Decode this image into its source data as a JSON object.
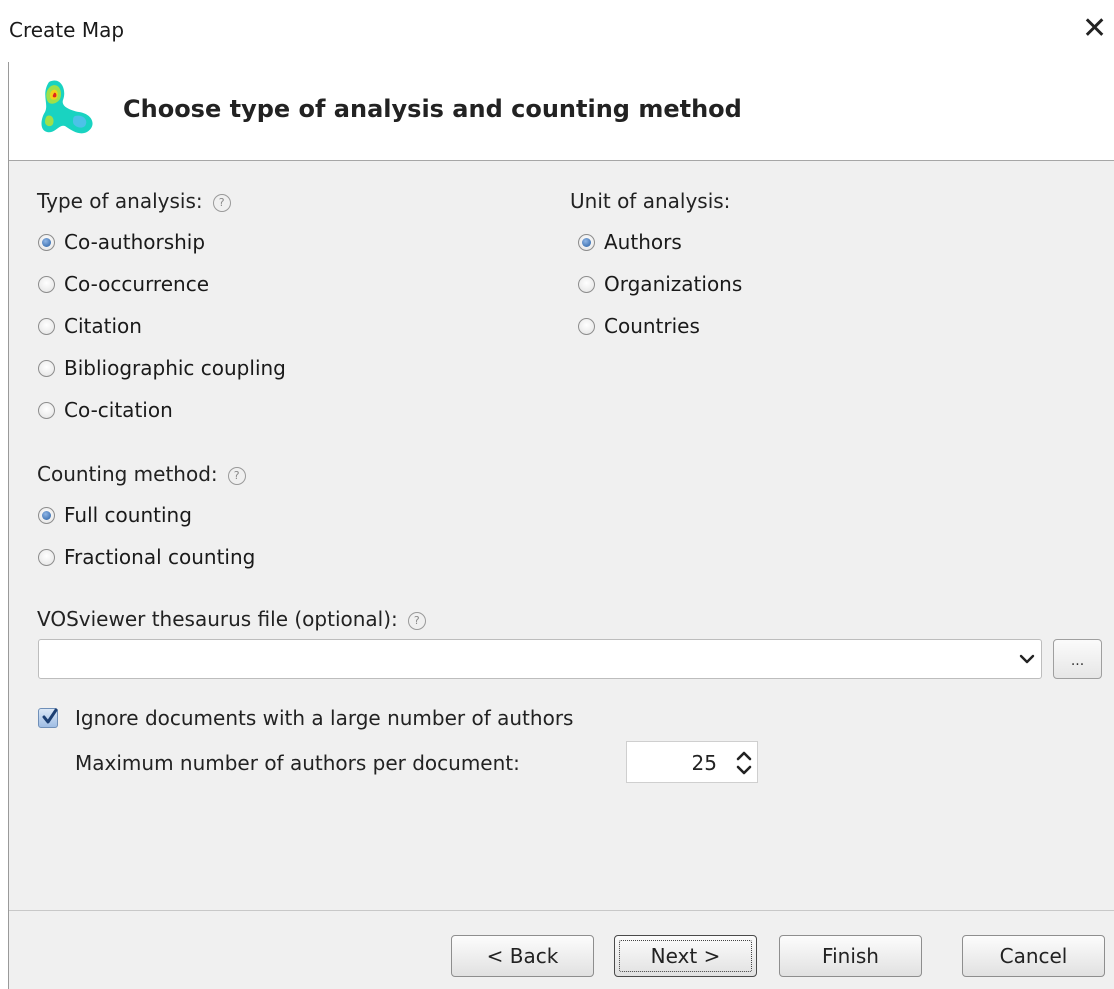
{
  "window": {
    "title": "Create Map"
  },
  "header": {
    "heading": "Choose type of analysis and counting method"
  },
  "type_of_analysis": {
    "label": "Type of analysis:",
    "options": [
      {
        "label": "Co-authorship",
        "checked": true
      },
      {
        "label": "Co-occurrence",
        "checked": false
      },
      {
        "label": "Citation",
        "checked": false
      },
      {
        "label": "Bibliographic coupling",
        "checked": false
      },
      {
        "label": "Co-citation",
        "checked": false
      }
    ]
  },
  "unit_of_analysis": {
    "label": "Unit of analysis:",
    "options": [
      {
        "label": "Authors",
        "checked": true
      },
      {
        "label": "Organizations",
        "checked": false
      },
      {
        "label": "Countries",
        "checked": false
      }
    ]
  },
  "counting_method": {
    "label": "Counting method:",
    "options": [
      {
        "label": "Full counting",
        "checked": true
      },
      {
        "label": "Fractional counting",
        "checked": false
      }
    ]
  },
  "thesaurus": {
    "label": "VOSviewer thesaurus file (optional):",
    "value": "",
    "browse_label": "..."
  },
  "ignore_docs": {
    "label": "Ignore documents with a large number of authors",
    "checked": true
  },
  "max_authors": {
    "label": "Maximum number of authors per document:",
    "value": "25"
  },
  "help_glyph": "?",
  "buttons": {
    "back": "< Back",
    "next": "Next >",
    "finish": "Finish",
    "cancel": "Cancel"
  },
  "colors": {
    "accent": "#3b6fb0",
    "panel_bg": "#f0f0f0",
    "separator": "#a6a6a6"
  }
}
